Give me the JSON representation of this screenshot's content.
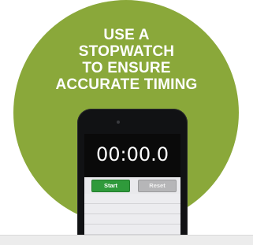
{
  "colors": {
    "circle": "#8aa83a",
    "start": "#2f9a3b",
    "reset": "#b6b6b8",
    "display": "#0a0a0a",
    "text": "#ffffff"
  },
  "headline": {
    "line1": "USE A",
    "line2": "STOPWATCH",
    "line3": "TO ENSURE",
    "line4": "ACCURATE TIMING"
  },
  "stopwatch": {
    "time": "00:00.0",
    "start_label": "Start",
    "reset_label": "Reset"
  },
  "icons": {
    "phone": "phone-icon",
    "speaker": "speaker-icon"
  }
}
